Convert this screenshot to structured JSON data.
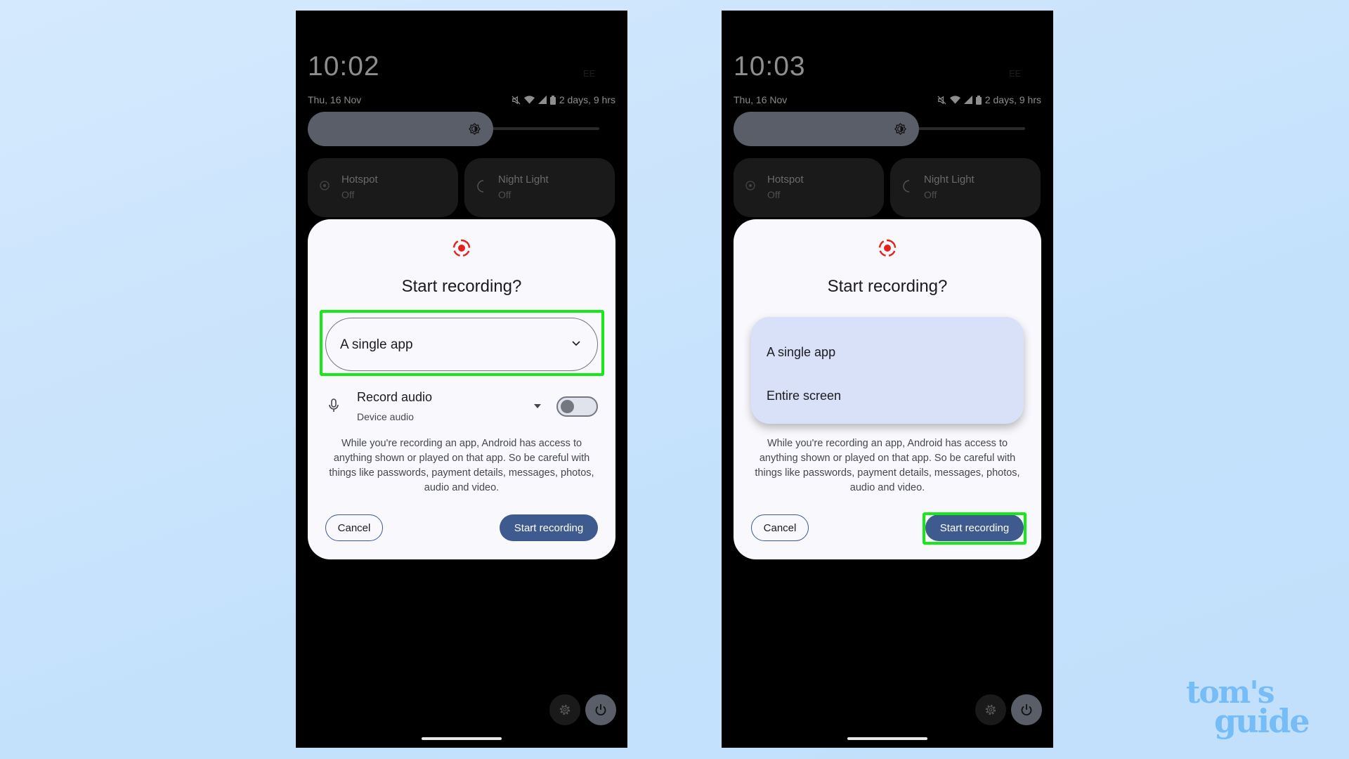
{
  "phones": [
    {
      "time": "10:02",
      "date": "Thu, 16 Nov",
      "carrier": "EE",
      "battery": "2 days, 9 hrs",
      "tiles": [
        {
          "label": "Hotspot",
          "state": "Off"
        },
        {
          "label": "Night Light",
          "state": "Off"
        }
      ],
      "dialog": {
        "title": "Start recording?",
        "select_value": "A single app",
        "record_audio": "Record audio",
        "audio_source": "Device audio",
        "record_audio_enabled": false,
        "description": "While you're recording an app, Android has access to anything shown or played on that app. So be careful with things like passwords, payment details, messages, photos, audio and video.",
        "cancel": "Cancel",
        "start": "Start recording"
      }
    },
    {
      "time": "10:03",
      "date": "Thu, 16 Nov",
      "carrier": "EE",
      "battery": "2 days, 9 hrs",
      "tiles": [
        {
          "label": "Hotspot",
          "state": "Off"
        },
        {
          "label": "Night Light",
          "state": "Off"
        }
      ],
      "dialog": {
        "title": "Start recording?",
        "menu_options": [
          "A single app",
          "Entire screen"
        ],
        "description": "While you're recording an app, Android has access to anything shown or played on that app. So be careful with things like passwords, payment details, messages, photos, audio and video.",
        "cancel": "Cancel",
        "start": "Start recording"
      }
    }
  ],
  "highlight_color": "#17e81a",
  "accent_color": "#3f5a8e",
  "record_icon_color": "#e3231b",
  "watermark": {
    "line1": "tom's",
    "line2": "guide"
  }
}
